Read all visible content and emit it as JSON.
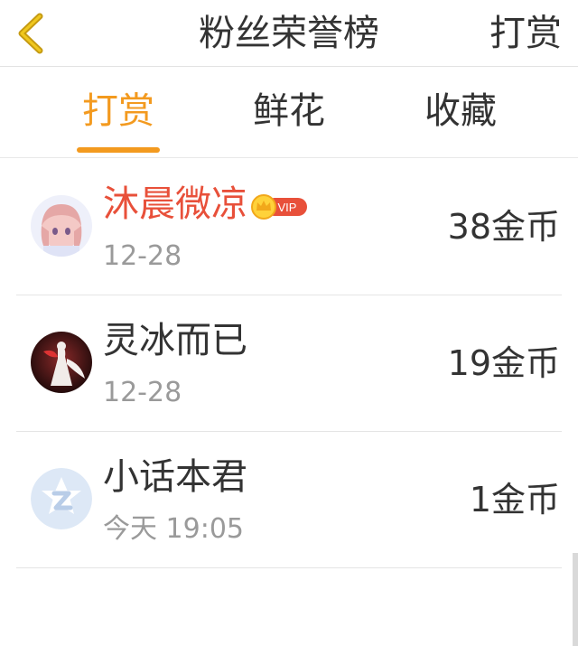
{
  "header": {
    "title": "粉丝荣誉榜",
    "action_label": "打赏"
  },
  "tabs": [
    {
      "label": "打赏",
      "active": true
    },
    {
      "label": "鲜花",
      "active": false
    },
    {
      "label": "收藏",
      "active": false
    }
  ],
  "fans": [
    {
      "name": "沐晨微凉",
      "vip": true,
      "vip_label": "VIP",
      "time": "12-28",
      "amount": "38金币"
    },
    {
      "name": "灵冰而已",
      "vip": false,
      "time": "12-28",
      "amount": "19金币"
    },
    {
      "name": "小话本君",
      "vip": false,
      "time": "今天 19:05",
      "amount": "1金币"
    }
  ],
  "colors": {
    "accent": "#f39a1f",
    "vip_name": "#e8503a",
    "secondary_text": "#9a9a9a"
  }
}
